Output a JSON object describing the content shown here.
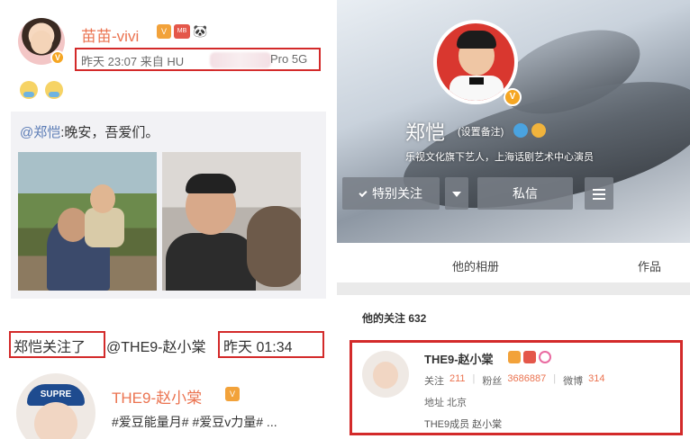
{
  "left_post": {
    "username": "苗苗-vivi",
    "meta_time": "昨天 23:07",
    "meta_source_prefix": "来自 HU",
    "meta_source_suffix": "Pro 5G",
    "repost": {
      "at_user": "@郑恺",
      "text": ":晚安，吾爱们。"
    }
  },
  "follow_activity": {
    "follow_text": "郑恺关注了",
    "target_user": "@THE9-赵小棠",
    "time": "昨天 01:34"
  },
  "followed_user_preview": {
    "name": "THE9-赵小棠",
    "cap_text": "SUPRE",
    "tags": "#爱豆能量月#    #爱豆v力量# ..."
  },
  "profile": {
    "name": "郑恺",
    "remark": "(设置备注)",
    "description": "乐视文化旗下艺人，上海话剧艺术中心演员",
    "buttons": {
      "follow": "特别关注",
      "message": "私信"
    },
    "tabs": [
      "他的相册",
      "作品"
    ],
    "follows_label": "他的关注 632",
    "follow_card": {
      "name": "THE9-赵小棠",
      "stats": [
        {
          "label": "关注",
          "value": "211"
        },
        {
          "label": "粉丝",
          "value": "3686887"
        },
        {
          "label": "微博",
          "value": "314"
        }
      ],
      "location": "地址 北京",
      "description": "THE9成员 赵小棠"
    }
  },
  "colors": {
    "accent_orange": "#eb7350",
    "highlight_red": "#d32a2a",
    "link_blue": "#5a7bb5"
  }
}
